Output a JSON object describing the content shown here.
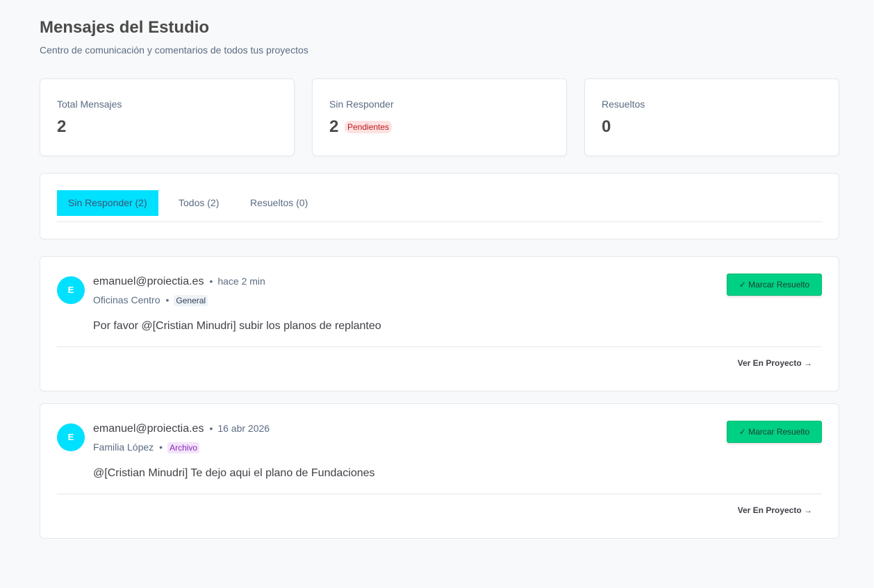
{
  "header": {
    "title": "Mensajes del Estudio",
    "subtitle": "Centro de comunicación y comentarios de todos tus proyectos"
  },
  "stats": [
    {
      "label": "Total Mensajes",
      "value": "2"
    },
    {
      "label": "Sin Responder",
      "value": "2",
      "badge": "Pendientes"
    },
    {
      "label": "Resueltos",
      "value": "0"
    }
  ],
  "tabs": [
    {
      "label": "Sin Responder (2)",
      "active": true
    },
    {
      "label": "Todos (2)",
      "active": false
    },
    {
      "label": "Resueltos (0)",
      "active": false
    }
  ],
  "messages": [
    {
      "avatar": "E",
      "author": "emanuel@proiectia.es",
      "time": "hace 2 min",
      "project": "Oficinas Centro",
      "tag": "General",
      "text": "Por favor @[Cristian Minudri] subir los planos de replanteo",
      "resolve_label": "✓ Marcar Resuelto",
      "view_label": "Ver En Proyecto →"
    },
    {
      "avatar": "E",
      "author": "emanuel@proiectia.es",
      "time": "16 abr 2026",
      "project": "Familia López",
      "tag": "Archivo",
      "text": "@[Cristian Minudri] Te dejo aqui el plano de Fundaciones",
      "resolve_label": "✓ Marcar Resuelto",
      "view_label": "Ver En Proyecto →"
    }
  ],
  "colors": {
    "accent": "#00e0ff",
    "success": "#00d084",
    "pending_badge_bg": "#fde2e2",
    "pending_badge_text": "#b91c1c"
  }
}
